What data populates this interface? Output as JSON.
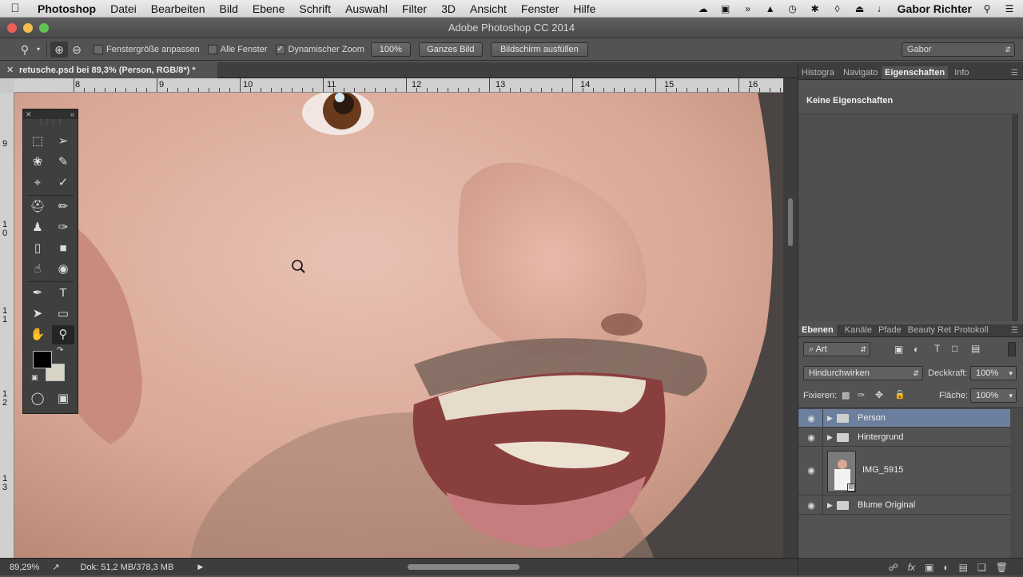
{
  "menubar": {
    "app": "Photoshop",
    "items": [
      "Datei",
      "Bearbeiten",
      "Bild",
      "Ebene",
      "Schrift",
      "Auswahl",
      "Filter",
      "3D",
      "Ansicht",
      "Fenster",
      "Hilfe"
    ],
    "user": "Gabor Richter"
  },
  "window": {
    "title": "Adobe Photoshop CC 2014"
  },
  "options": {
    "fit_window": "Fenstergröße anpassen",
    "all_windows": "Alle Fenster",
    "scrubby_zoom": "Dynamischer Zoom",
    "btn_100": "100%",
    "btn_fit": "Ganzes Bild",
    "btn_fill": "Bildschirm ausfüllen",
    "workspace": "Gabor"
  },
  "document": {
    "tab_title": "retusche.psd bei 89,3% (Person, RGB/8*) *",
    "ruler_h": [
      "8",
      "9",
      "10",
      "11",
      "12",
      "13",
      "14",
      "15",
      "16"
    ],
    "ruler_v": [
      "9",
      "1 0",
      "1 1",
      "1 2",
      "1 3"
    ]
  },
  "status": {
    "zoom": "89,29%",
    "doc": "Dok: 51,2 MB/378,3 MB"
  },
  "properties_panel": {
    "tabs": [
      "Histogra",
      "Navigato",
      "Eigenschaften",
      "Info"
    ],
    "empty_text": "Keine Eigenschaften"
  },
  "layers_panel": {
    "tabs": [
      "Ebenen",
      "Kanäle",
      "Pfade",
      "Beauty Ret",
      "Protokoll"
    ],
    "filter_kind": "Art",
    "blend_mode": "Hindurchwirken",
    "opacity_label": "Deckkraft:",
    "opacity_value": "100%",
    "lock_label": "Fixieren:",
    "fill_label": "Fläche:",
    "fill_value": "100%",
    "layers": [
      {
        "name": "Person"
      },
      {
        "name": "Hintergrund"
      },
      {
        "name": "IMG_5915"
      },
      {
        "name": "Blume Original"
      }
    ]
  },
  "colors": {
    "foreground": "#000000",
    "background": "#d9d5c6",
    "selected_layer": "#6c7f9e"
  }
}
